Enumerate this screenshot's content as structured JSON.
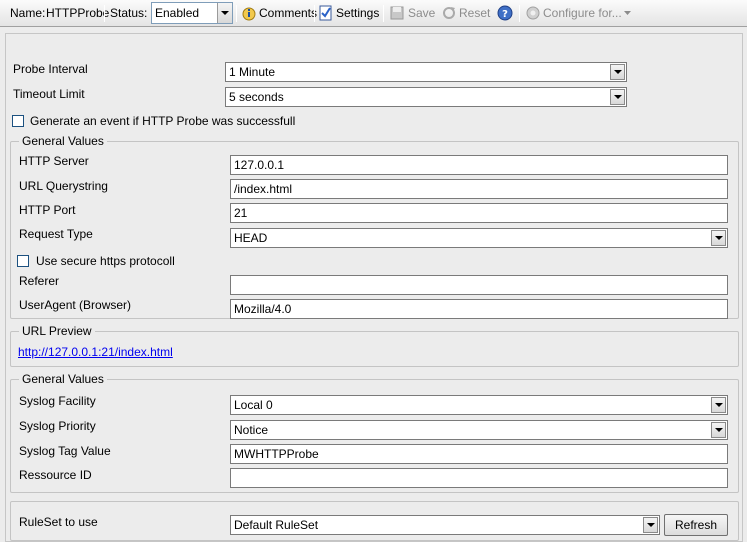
{
  "toolbar": {
    "name_label": "Name:",
    "name_value": "HTTPProbe",
    "status_label": "Status:",
    "status_value": "Enabled",
    "comments_label": "Comments",
    "settings_label": "Settings",
    "save_label": "Save",
    "reset_label": "Reset",
    "configure_label": "Configure for..."
  },
  "probe": {
    "interval_label": "Probe Interval",
    "interval_value": "1 Minute",
    "timeout_label": "Timeout Limit",
    "timeout_value": "5 seconds",
    "generate_event_label": "Generate an event if HTTP Probe was successfull",
    "generate_event_checked": false
  },
  "general_values": {
    "title": "General Values",
    "http_server_label": "HTTP Server",
    "http_server_value": "127.0.0.1",
    "url_query_label": "URL  Querystring",
    "url_query_value": "/index.html",
    "http_port_label": "HTTP Port",
    "http_port_value": "21",
    "request_type_label": "Request Type",
    "request_type_value": "HEAD",
    "secure_https_label": "Use secure https protocoll",
    "secure_https_checked": false,
    "referer_label": "Referer",
    "referer_value": "",
    "useragent_label": "UserAgent (Browser)",
    "useragent_value": "Mozilla/4.0"
  },
  "url_preview": {
    "title": "URL Preview",
    "link": "http://127.0.0.1:21/index.html"
  },
  "syslog": {
    "title": "General Values",
    "facility_label": "Syslog Facility",
    "facility_value": "Local 0",
    "priority_label": "Syslog Priority",
    "priority_value": "Notice",
    "tag_label": "Syslog Tag Value",
    "tag_value": "MWHTTPProbe",
    "resource_label": "Ressource ID",
    "resource_value": ""
  },
  "ruleset": {
    "label": "RuleSet to use",
    "value": "Default RuleSet",
    "refresh_label": "Refresh"
  },
  "colors": {
    "link": "#0000ee",
    "background": "#ececec",
    "field_border": "#7a7a7a"
  }
}
